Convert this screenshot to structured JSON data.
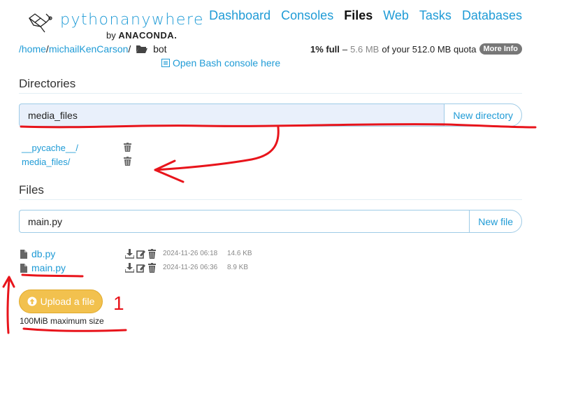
{
  "brand": {
    "name_part1": "python",
    "name_part2": "anywhere",
    "by": "by",
    "company": "ANACONDA.",
    "logo_icon": "pythonanywhere-logo-icon"
  },
  "nav": {
    "items": [
      "Dashboard",
      "Consoles",
      "Files",
      "Web",
      "Tasks",
      "Databases"
    ],
    "active": "Files"
  },
  "breadcrumb": {
    "root": "/home",
    "sep1": "/",
    "user": "michailKenCarson",
    "sep2": "/",
    "current": "bot"
  },
  "bash_link": "Open Bash console here",
  "quota": {
    "used_label": "1% full",
    "dash": "–",
    "used": "5.6 MB",
    "text": "of your 512.0 MB quota",
    "more_info": "More Info"
  },
  "directories": {
    "title": "Directories",
    "input_value": "media_files",
    "button": "New directory",
    "items": [
      "__pycache__/",
      "media_files/"
    ]
  },
  "files": {
    "title": "Files",
    "input_value": "main.py",
    "button": "New file",
    "items": [
      {
        "name": "db.py",
        "date": "2024-11-26 06:18",
        "size": "14.6 KB"
      },
      {
        "name": "main.py",
        "date": "2024-11-26 06:36",
        "size": "8.9 KB"
      }
    ]
  },
  "upload": {
    "label": "Upload a file",
    "note": "100MiB maximum size"
  },
  "annotation": {
    "number": "1",
    "color": "#e8141b"
  },
  "colors": {
    "link": "#1f9bd6",
    "upload": "#f2c14e",
    "input_fill": "#e9f0fb"
  }
}
